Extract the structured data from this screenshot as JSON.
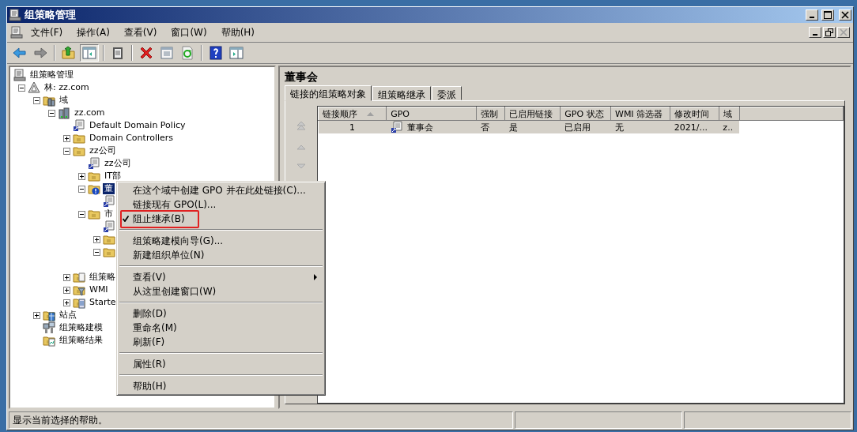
{
  "window": {
    "title": "组策略管理"
  },
  "menubar": {
    "items": [
      {
        "label": "文件(F)"
      },
      {
        "label": "操作(A)"
      },
      {
        "label": "查看(V)"
      },
      {
        "label": "窗口(W)"
      },
      {
        "label": "帮助(H)"
      }
    ]
  },
  "toolbar": {
    "buttons": [
      {
        "pressed": false
      },
      {
        "pressed": false
      },
      {
        "pressed": false
      },
      {
        "pressed": true
      },
      {
        "pressed": false
      },
      {
        "pressed": false
      },
      {
        "pressed": false
      },
      {
        "pressed": false
      },
      {
        "pressed": false
      },
      {
        "pressed": false
      }
    ]
  },
  "tree": {
    "items": [
      {
        "label": "组策略管理",
        "kind": "console",
        "selected": false,
        "children": [
          {
            "label": "林: zz.com",
            "kind": "forest",
            "expanded": true,
            "selected": false,
            "children": [
              {
                "label": "域",
                "kind": "domains",
                "expanded": true,
                "selected": false,
                "children": [
                  {
                    "label": "zz.com",
                    "kind": "domain",
                    "expanded": true,
                    "selected": false,
                    "children": [
                      {
                        "label": "Default Domain Policy",
                        "kind": "gpo_link",
                        "selected": false
                      },
                      {
                        "label": "Domain Controllers",
                        "kind": "ou",
                        "expanded": false,
                        "selected": false
                      },
                      {
                        "label": "zz公司",
                        "kind": "ou",
                        "expanded": true,
                        "selected": false,
                        "children": [
                          {
                            "label": "zz公司",
                            "kind": "gpo_link",
                            "selected": false
                          },
                          {
                            "label": "IT部",
                            "kind": "ou",
                            "expanded": false,
                            "selected": false
                          },
                          {
                            "label": "董",
                            "kind": "blocked_ou",
                            "expanded": true,
                            "selected": true,
                            "children": [
                              {
                                "kind": "gpo_link"
                              }
                            ]
                          },
                          {
                            "label": "市",
                            "kind": "ou",
                            "expanded": true,
                            "selected": false,
                            "children": [
                              {
                                "kind": "gpo_link"
                              },
                              {
                                "kind": "ou",
                                "expanded": false
                              },
                              {
                                "kind": "ou",
                                "expanded": true
                              }
                            ]
                          }
                        ]
                      },
                      {
                        "label": "组策略",
                        "kind": "gpo_container",
                        "expanded": false,
                        "selected": false
                      },
                      {
                        "label": "WMI",
                        "kind": "wmi_container",
                        "expanded": false,
                        "selected": false
                      },
                      {
                        "label": "Starte",
                        "kind": "starter_container",
                        "expanded": false,
                        "selected": false
                      }
                    ]
                  }
                ]
              },
              {
                "label": "站点",
                "kind": "sites",
                "expanded": false,
                "selected": false
              },
              {
                "label": "组策略建模",
                "kind": "modeling",
                "selected": false
              },
              {
                "label": "组策略结果",
                "kind": "results",
                "selected": false
              }
            ]
          }
        ]
      }
    ]
  },
  "detail": {
    "title": "董事会",
    "tabs": [
      {
        "label": "链接的组策略对象",
        "selected": true
      },
      {
        "label": "组策略继承",
        "selected": false
      },
      {
        "label": "委派",
        "selected": false
      }
    ],
    "table": {
      "columns": [
        {
          "label": "链接顺序",
          "sorted": true
        },
        {
          "label": "GPO",
          "sorted": false
        },
        {
          "label": "强制",
          "sorted": false
        },
        {
          "label": "已启用链接",
          "sorted": false
        },
        {
          "label": "GPO 状态",
          "sorted": false
        },
        {
          "label": "WMI 筛选器",
          "sorted": false
        },
        {
          "label": "修改时间",
          "sorted": false
        },
        {
          "label": "域",
          "sorted": false
        }
      ],
      "rows": [
        {
          "selected": true,
          "cells": [
            "1",
            "董事会",
            "否",
            "是",
            "已启用",
            "无",
            "2021/...",
            "z.."
          ]
        }
      ]
    }
  },
  "menu": {
    "items": [
      {
        "kind": "item",
        "label": "在这个域中创建 GPO 并在此处链接(C)..."
      },
      {
        "kind": "item",
        "label": "链接现有 GPO(L)..."
      },
      {
        "kind": "item",
        "label": "阻止继承(B)",
        "checked": true,
        "highlighted": true
      },
      {
        "kind": "separator"
      },
      {
        "kind": "item",
        "label": "组策略建模向导(G)..."
      },
      {
        "kind": "item",
        "label": "新建组织单位(N)"
      },
      {
        "kind": "separator"
      },
      {
        "kind": "item",
        "label": "查看(V)",
        "submenu": true
      },
      {
        "kind": "item",
        "label": "从这里创建窗口(W)"
      },
      {
        "kind": "separator"
      },
      {
        "kind": "item",
        "label": "删除(D)"
      },
      {
        "kind": "item",
        "label": "重命名(M)"
      },
      {
        "kind": "item",
        "label": "刷新(F)"
      },
      {
        "kind": "separator"
      },
      {
        "kind": "item",
        "label": "属性(R)"
      },
      {
        "kind": "separator"
      },
      {
        "kind": "item",
        "label": "帮助(H)"
      }
    ]
  },
  "status_bar": {
    "text": "显示当前选择的帮助。"
  }
}
